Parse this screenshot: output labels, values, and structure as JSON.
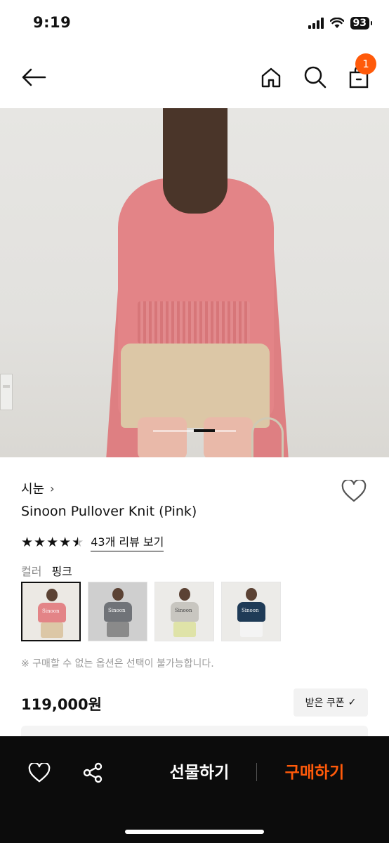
{
  "status_bar": {
    "time": "9:19",
    "battery": "93",
    "icons": [
      "signal-icon",
      "wifi-icon",
      "battery-icon"
    ]
  },
  "nav": {
    "icons": [
      "back-arrow-icon",
      "home-icon",
      "search-icon",
      "shopping-bag-icon"
    ],
    "cart_count": "1",
    "badge_color": "#ff5a0a"
  },
  "product": {
    "brand": "시눈",
    "brand_chevron": "›",
    "name": "Sinoon Pullover Knit (Pink)",
    "rating": 4.5,
    "review_link": "43개 리뷰 보기",
    "color_label": "컬러",
    "color_value": "핑크",
    "option_thumbnails": [
      {
        "label": "Sinoon",
        "selected": true
      },
      {
        "label": "Sinoon",
        "selected": false
      },
      {
        "label": "Sinoon",
        "selected": false
      },
      {
        "label": "Sinoon",
        "selected": false
      }
    ],
    "notice": "※ 구매할 수 없는 옵션은 선택이 불가능합니다.",
    "price": "119,000원",
    "coupon_button": "받은 쿠폰",
    "coupon_check": "✓"
  },
  "bottom_bar": {
    "icons": [
      "heart-icon",
      "share-icon"
    ],
    "gift_label": "선물하기",
    "buy_label": "구매하기",
    "buy_color": "#ff5a0a"
  }
}
